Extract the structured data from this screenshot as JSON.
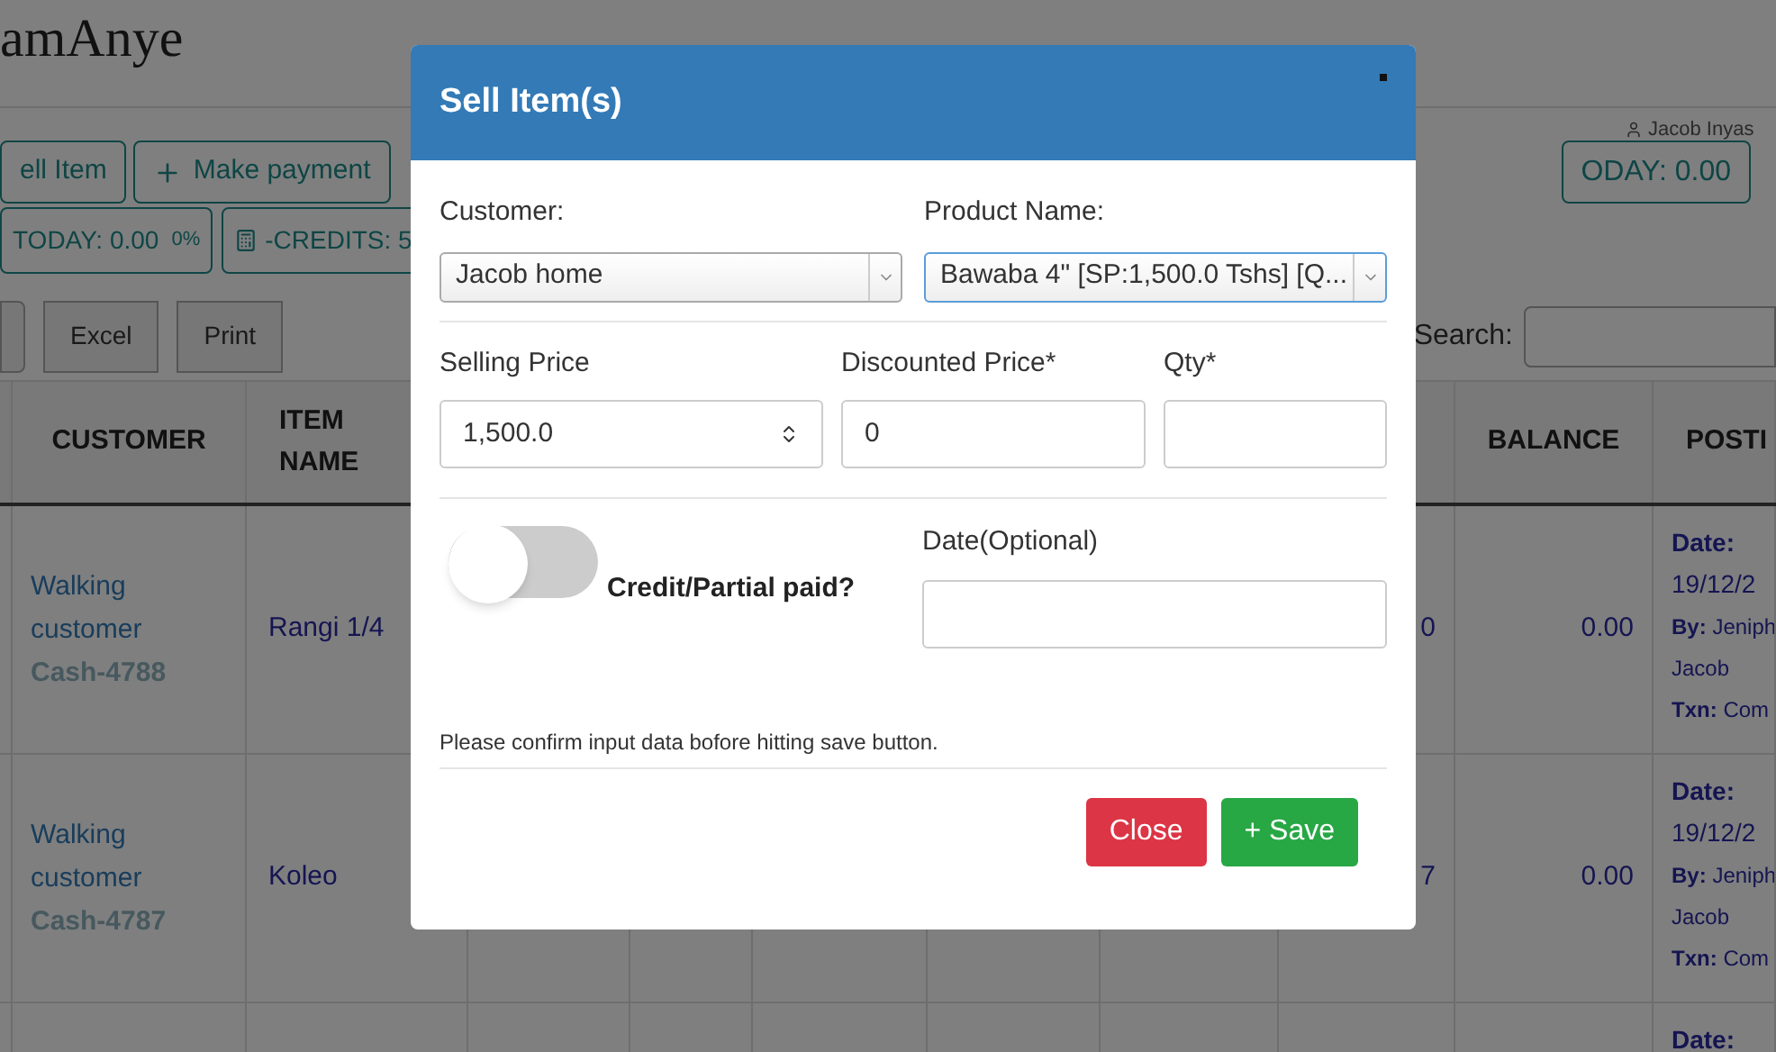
{
  "page": {
    "title": "amAnye",
    "user": "Jacob Inyas"
  },
  "actions": [
    {
      "label": "ell Item",
      "kind": "plain"
    },
    {
      "label": "Make payment",
      "kind": "add"
    }
  ],
  "right_stat": "ODAY: 0.00",
  "stats": [
    {
      "label": "TODAY: 0.00",
      "suffix": "0%",
      "kind": "plain"
    },
    {
      "label": "-CREDITS: 5",
      "kind": "calculator"
    }
  ],
  "exports": [
    "Excel",
    "Print"
  ],
  "search": {
    "label": "Search:"
  },
  "table": {
    "columns": {
      "customer": "CUSTOMER",
      "item": "ITEM NAME",
      "balance": "BALANCE",
      "posting": "POSTI"
    },
    "rows": [
      {
        "customer": "Walking customer",
        "receipt": "Cash-4788",
        "item": "Rangi 1/4",
        "column_8": "0",
        "balance": "0.00",
        "posting": {
          "date_label": "Date:",
          "date": "19/12/2",
          "by_label": "By:",
          "by": "Jeniph",
          "by_line2": "Jacob",
          "txn_label": "Txn:",
          "txn": "Com"
        }
      },
      {
        "customer": "Walking customer",
        "receipt": "Cash-4787",
        "item": "Koleo",
        "column_8": "7",
        "balance": "0.00",
        "posting": {
          "date_label": "Date:",
          "date": "19/12/2",
          "by_label": "By:",
          "by": "Jeniph",
          "by_line2": "Jacob",
          "txn_label": "Txn:",
          "txn": "Com"
        }
      },
      {
        "posting": {
          "date_label": "Date:"
        }
      }
    ]
  },
  "modal": {
    "title": "Sell Item(s)",
    "customer": {
      "label": "Customer:",
      "value": "Jacob home"
    },
    "product": {
      "label": "Product Name:",
      "value": "Bawaba 4\" [SP:1,500.0 Tshs] [Q..."
    },
    "selling_price": {
      "label": "Selling Price",
      "value": "1,500.0"
    },
    "discounted_price": {
      "label": "Discounted Price*",
      "value": "0"
    },
    "qty": {
      "label": "Qty*"
    },
    "credit": {
      "label": "Credit/Partial paid?",
      "on": false
    },
    "date": {
      "label": "Date(Optional)"
    },
    "note": "Please confirm input data bofore hitting save button.",
    "buttons": [
      {
        "label": "Close",
        "kind": "danger"
      },
      {
        "label": "+ Save",
        "kind": "success"
      }
    ]
  }
}
